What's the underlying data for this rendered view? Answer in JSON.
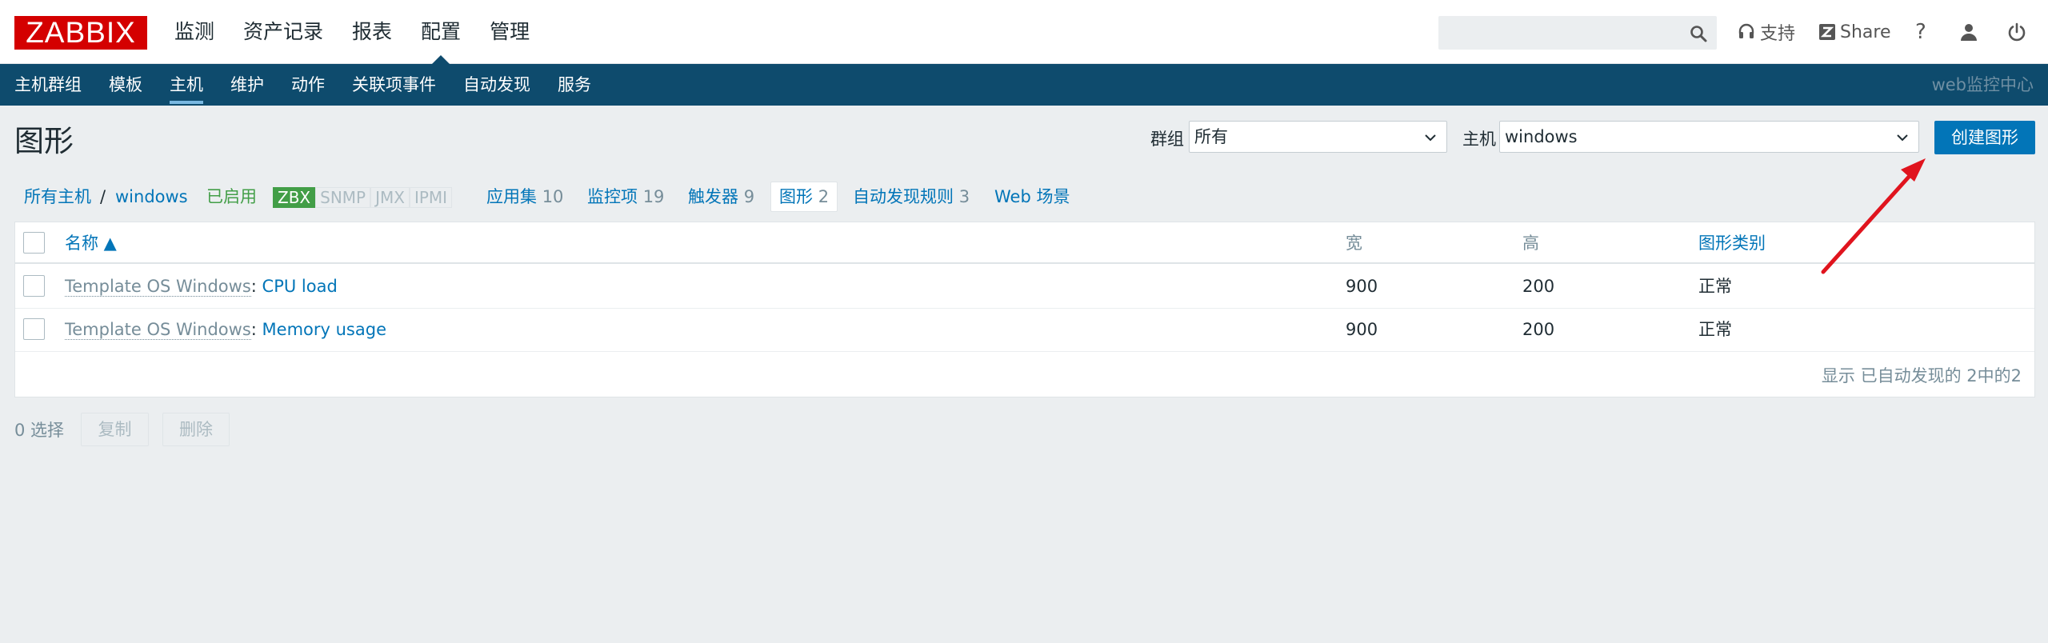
{
  "header": {
    "logo": "ZABBIX",
    "nav": [
      "监测",
      "资产记录",
      "报表",
      "配置",
      "管理"
    ],
    "active_nav": "配置",
    "search": {
      "value": "",
      "placeholder": ""
    },
    "support": "支持",
    "share": "Share",
    "help": "?"
  },
  "subnav": {
    "items": [
      "主机群组",
      "模板",
      "主机",
      "维护",
      "动作",
      "关联项事件",
      "自动发现",
      "服务"
    ],
    "active": "主机",
    "right": "web监控中心"
  },
  "page": {
    "title": "图形",
    "filter": {
      "group_label": "群组",
      "group_value": "所有",
      "host_label": "主机",
      "host_value": "windows"
    },
    "create_button": "创建图形"
  },
  "hostnav": {
    "all_hosts": "所有主机",
    "separator": "/",
    "host": "windows",
    "status": "已启用",
    "interfaces": [
      {
        "label": "ZBX",
        "active": true
      },
      {
        "label": "SNMP",
        "active": false
      },
      {
        "label": "JMX",
        "active": false
      },
      {
        "label": "IPMI",
        "active": false
      }
    ],
    "links": [
      {
        "label": "应用集",
        "count": "10"
      },
      {
        "label": "监控项",
        "count": "19"
      },
      {
        "label": "触发器",
        "count": "9"
      },
      {
        "label": "图形",
        "count": "2"
      },
      {
        "label": "自动发现规则",
        "count": "3"
      },
      {
        "label": "Web 场景",
        "count": ""
      }
    ]
  },
  "table": {
    "columns": [
      "名称 ▲",
      "宽",
      "高",
      "图形类别"
    ],
    "rows": [
      {
        "template": "Template OS Windows",
        "sep": ": ",
        "name": "CPU load",
        "width": "900",
        "height": "200",
        "type": "正常"
      },
      {
        "template": "Template OS Windows",
        "sep": ": ",
        "name": "Memory usage",
        "width": "900",
        "height": "200",
        "type": "正常"
      }
    ],
    "footer": "显示 已自动发现的 2中的2"
  },
  "actions": {
    "selected": "0 选择",
    "copy": "复制",
    "delete": "删除"
  },
  "colors": {
    "brand": "#d40000",
    "nav_bg": "#0e4b6d",
    "link": "#0275b8",
    "enabled": "#429e47",
    "annotation_arrow": "#e0141e"
  }
}
